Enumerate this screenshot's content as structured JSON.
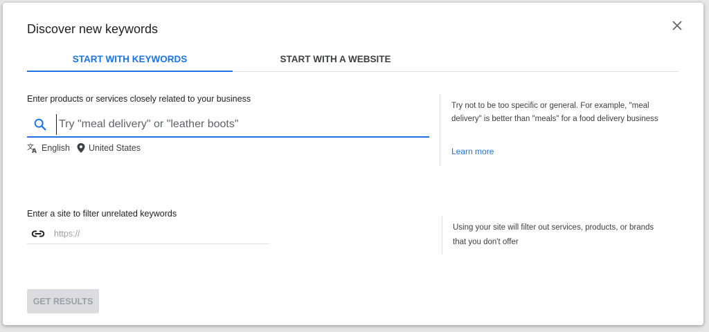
{
  "dialog": {
    "title": "Discover new keywords",
    "close_icon": "close-icon"
  },
  "tabs": [
    {
      "label": "START WITH KEYWORDS",
      "active": true
    },
    {
      "label": "START WITH A WEBSITE",
      "active": false
    }
  ],
  "keywords": {
    "label": "Enter products or services closely related to your business",
    "placeholder": "Try \"meal delivery\" or \"leather boots\"",
    "value": "",
    "language": "English",
    "location": "United States",
    "hint": "Try not to be too specific or general. For example, \"meal delivery\" is better than \"meals\" for a food delivery business",
    "learn_more": "Learn more"
  },
  "site": {
    "label": "Enter a site to filter unrelated keywords",
    "placeholder": "https://",
    "value": "",
    "hint": "Using your site will filter out services, products, or brands that you don't offer"
  },
  "actions": {
    "get_results": "GET RESULTS",
    "get_results_enabled": false
  },
  "colors": {
    "accent": "#1a73e8",
    "disabled_bg": "#dadce0",
    "disabled_text": "#9aa0a6"
  }
}
